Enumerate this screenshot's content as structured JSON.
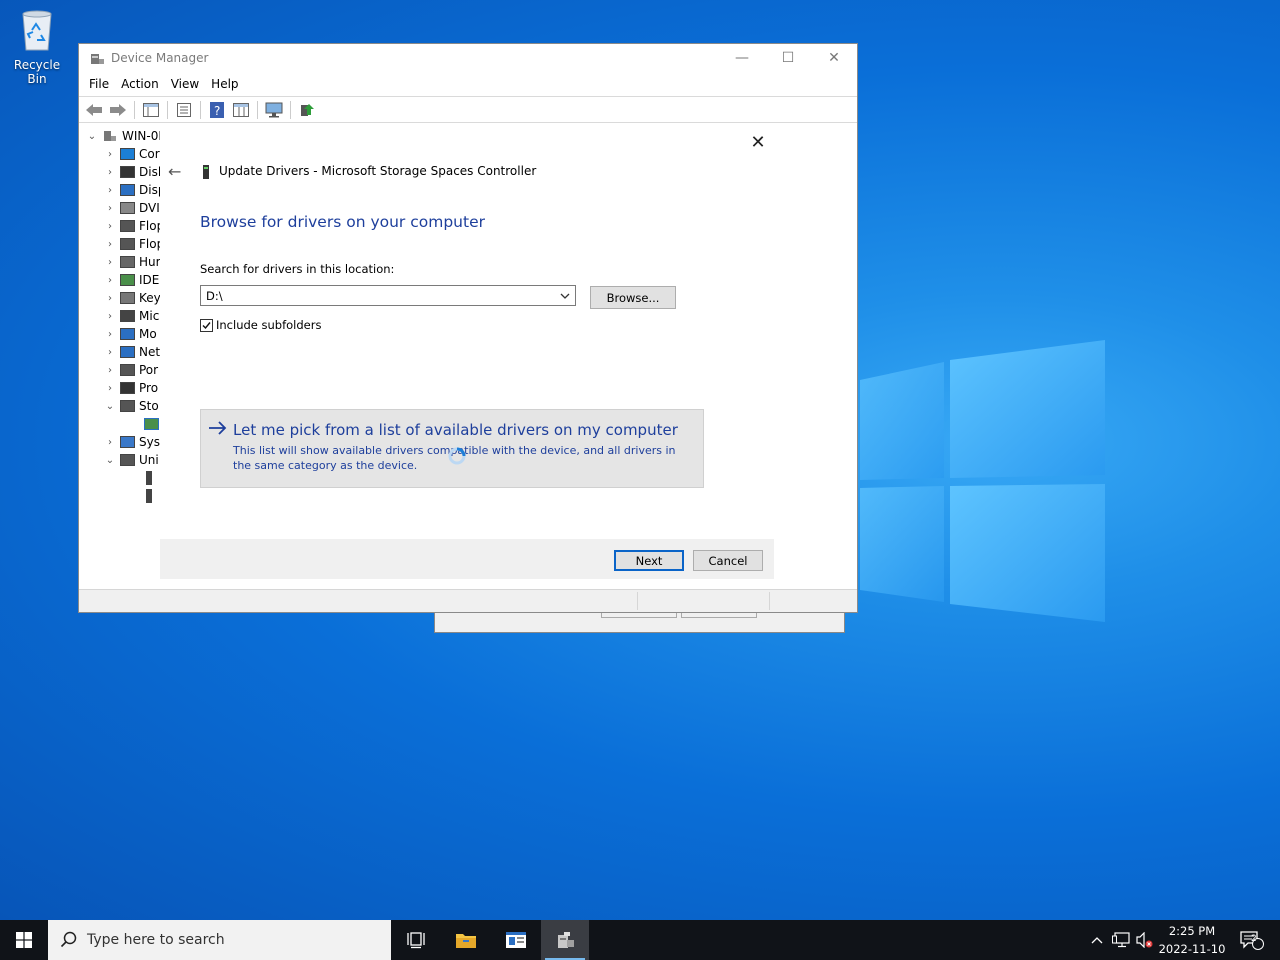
{
  "desktop": {
    "recycle_bin_label": "Recycle Bin"
  },
  "device_manager": {
    "title": "Device Manager",
    "menu": [
      "File",
      "Action",
      "View",
      "Help"
    ],
    "tree": {
      "root": "WIN-0F",
      "items": [
        "Cor",
        "Disl",
        "Disp",
        "DVI",
        "Flop",
        "Flop",
        "Hur",
        "IDE",
        "Key",
        "Mic",
        "Mo",
        "Net",
        "Por",
        "Pro",
        "Sto",
        "Sys",
        "Uni"
      ]
    }
  },
  "wizard": {
    "header_title": "Update Drivers - Microsoft Storage Spaces Controller",
    "heading": "Browse for drivers on your computer",
    "search_label": "Search for drivers in this location:",
    "location_value": "D:\\",
    "browse_label": "Browse...",
    "include_subfolders_label": "Include subfolders",
    "include_subfolders_checked": true,
    "pick_title": "Let me pick from a list of available drivers on my computer",
    "pick_desc": "This list will show available drivers compatible with the device, and all drivers in the same category as the device.",
    "next_label": "Next",
    "cancel_label": "Cancel"
  },
  "taskbar": {
    "search_placeholder": "Type here to search",
    "time": "2:25 PM",
    "date": "2022-11-10",
    "notification_count": "2"
  }
}
